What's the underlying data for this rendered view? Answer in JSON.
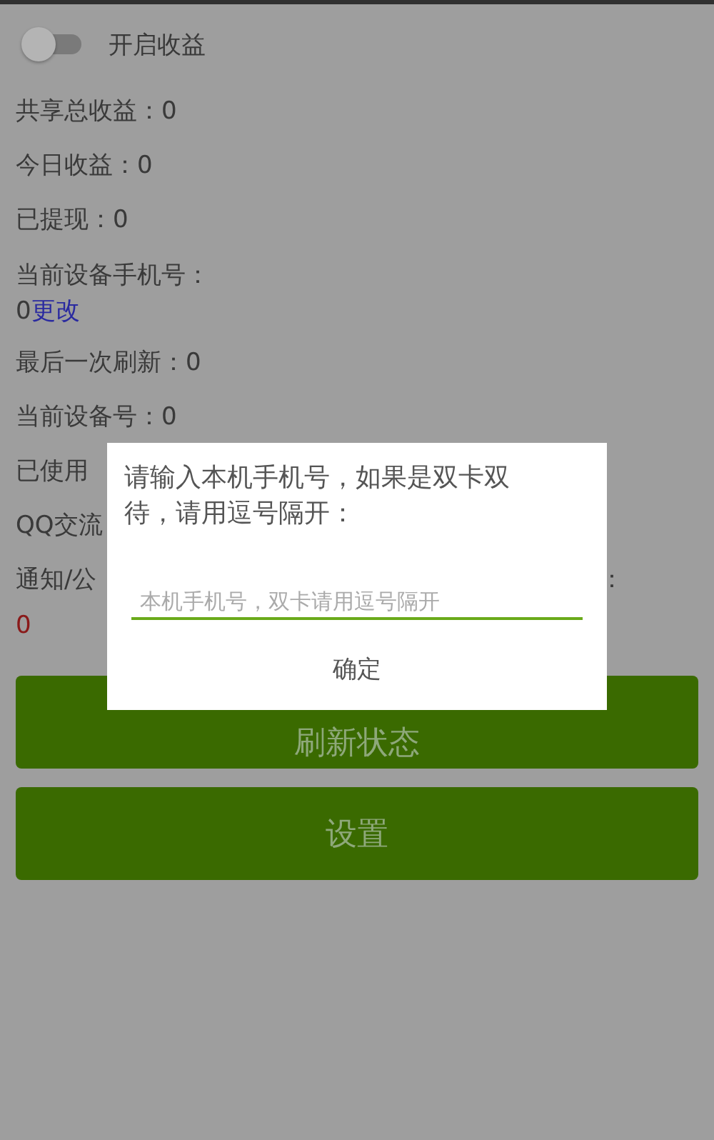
{
  "switch": {
    "label": "开启收益",
    "on": false
  },
  "stats": [
    {
      "text": "共享总收益：0"
    },
    {
      "text": "今日收益：0"
    },
    {
      "text": "已提现：0"
    }
  ],
  "phone": {
    "label": "当前设备手机号：",
    "value": "0",
    "link": "更改"
  },
  "stats2": [
    {
      "text": "最后一次刷新：0"
    },
    {
      "text": "当前设备号：0"
    },
    {
      "text": "已使用"
    },
    {
      "text": "QQ交流"
    }
  ],
  "notice": {
    "label": "通知/公",
    "tail": "：",
    "value": "0"
  },
  "buttons": [
    "刷新状态",
    "设置"
  ],
  "dialog": {
    "message": "请输入本机手机号，如果是双卡双待，请用逗号隔开：",
    "placeholder": "本机手机号，双卡请用逗号隔开",
    "confirm": "确定"
  }
}
